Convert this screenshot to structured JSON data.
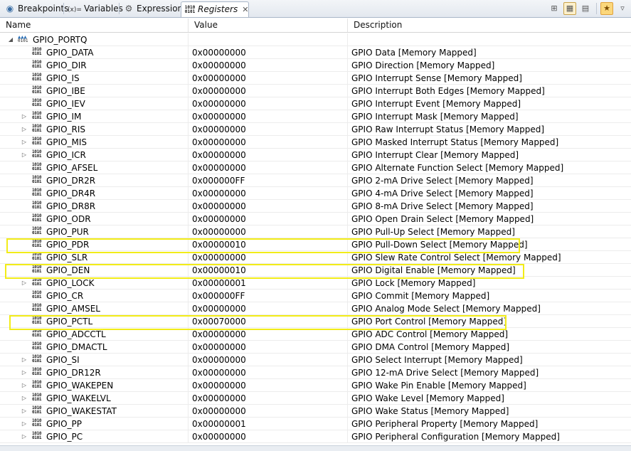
{
  "tabs": [
    {
      "label": "Breakpoints",
      "icon": "breakpoints-icon",
      "glyph": "⚬"
    },
    {
      "label": "Variables",
      "icon": "variables-icon",
      "glyph": "(x)="
    },
    {
      "label": "Expressions",
      "icon": "expressions-icon",
      "glyph": "⛭"
    },
    {
      "label": "Registers",
      "icon": "registers-icon",
      "glyph": "1010"
    }
  ],
  "columns": {
    "name": "Name",
    "value": "Value",
    "description": "Description"
  },
  "group": {
    "name": "GPIO_PORTQ",
    "expanded": true
  },
  "registers": [
    {
      "name": "GPIO_DATA",
      "value": "0x00000000",
      "description": "GPIO Data [Memory Mapped]",
      "expandable": false
    },
    {
      "name": "GPIO_DIR",
      "value": "0x00000000",
      "description": "GPIO Direction [Memory Mapped]",
      "expandable": false
    },
    {
      "name": "GPIO_IS",
      "value": "0x00000000",
      "description": "GPIO Interrupt Sense [Memory Mapped]",
      "expandable": false
    },
    {
      "name": "GPIO_IBE",
      "value": "0x00000000",
      "description": "GPIO Interrupt Both Edges [Memory Mapped]",
      "expandable": false
    },
    {
      "name": "GPIO_IEV",
      "value": "0x00000000",
      "description": "GPIO Interrupt Event [Memory Mapped]",
      "expandable": false
    },
    {
      "name": "GPIO_IM",
      "value": "0x00000000",
      "description": "GPIO Interrupt Mask [Memory Mapped]",
      "expandable": true
    },
    {
      "name": "GPIO_RIS",
      "value": "0x00000000",
      "description": "GPIO Raw Interrupt Status [Memory Mapped]",
      "expandable": true
    },
    {
      "name": "GPIO_MIS",
      "value": "0x00000000",
      "description": "GPIO Masked Interrupt Status [Memory Mapped]",
      "expandable": true
    },
    {
      "name": "GPIO_ICR",
      "value": "0x00000000",
      "description": "GPIO Interrupt Clear [Memory Mapped]",
      "expandable": true
    },
    {
      "name": "GPIO_AFSEL",
      "value": "0x00000000",
      "description": "GPIO Alternate Function Select [Memory Mapped]",
      "expandable": false
    },
    {
      "name": "GPIO_DR2R",
      "value": "0x000000FF",
      "description": "GPIO 2-mA Drive Select [Memory Mapped]",
      "expandable": false
    },
    {
      "name": "GPIO_DR4R",
      "value": "0x00000000",
      "description": "GPIO 4-mA Drive Select [Memory Mapped]",
      "expandable": false
    },
    {
      "name": "GPIO_DR8R",
      "value": "0x00000000",
      "description": "GPIO 8-mA Drive Select [Memory Mapped]",
      "expandable": false
    },
    {
      "name": "GPIO_ODR",
      "value": "0x00000000",
      "description": "GPIO Open Drain Select [Memory Mapped]",
      "expandable": false
    },
    {
      "name": "GPIO_PUR",
      "value": "0x00000000",
      "description": "GPIO Pull-Up Select [Memory Mapped]",
      "expandable": false
    },
    {
      "name": "GPIO_PDR",
      "value": "0x00000010",
      "description": "GPIO Pull-Down Select [Memory Mapped]",
      "expandable": false,
      "highlighted": true
    },
    {
      "name": "GPIO_SLR",
      "value": "0x00000000",
      "description": "GPIO Slew Rate Control Select [Memory Mapped]",
      "expandable": false
    },
    {
      "name": "GPIO_DEN",
      "value": "0x00000010",
      "description": "GPIO Digital Enable [Memory Mapped]",
      "expandable": false,
      "highlighted": true
    },
    {
      "name": "GPIO_LOCK",
      "value": "0x00000001",
      "description": "GPIO Lock [Memory Mapped]",
      "expandable": true
    },
    {
      "name": "GPIO_CR",
      "value": "0x000000FF",
      "description": "GPIO Commit [Memory Mapped]",
      "expandable": false
    },
    {
      "name": "GPIO_AMSEL",
      "value": "0x00000000",
      "description": "GPIO Analog Mode Select [Memory Mapped]",
      "expandable": false
    },
    {
      "name": "GPIO_PCTL",
      "value": "0x00070000",
      "description": "GPIO Port Control [Memory Mapped]",
      "expandable": false,
      "highlighted": true
    },
    {
      "name": "GPIO_ADCCTL",
      "value": "0x00000000",
      "description": "GPIO ADC Control [Memory Mapped]",
      "expandable": false
    },
    {
      "name": "GPIO_DMACTL",
      "value": "0x00000000",
      "description": "GPIO DMA Control [Memory Mapped]",
      "expandable": false
    },
    {
      "name": "GPIO_SI",
      "value": "0x00000000",
      "description": "GPIO Select Interrupt [Memory Mapped]",
      "expandable": true
    },
    {
      "name": "GPIO_DR12R",
      "value": "0x00000000",
      "description": "GPIO 12-mA Drive Select [Memory Mapped]",
      "expandable": true
    },
    {
      "name": "GPIO_WAKEPEN",
      "value": "0x00000000",
      "description": "GPIO Wake Pin Enable [Memory Mapped]",
      "expandable": true
    },
    {
      "name": "GPIO_WAKELVL",
      "value": "0x00000000",
      "description": "GPIO Wake Level [Memory Mapped]",
      "expandable": true
    },
    {
      "name": "GPIO_WAKESTAT",
      "value": "0x00000000",
      "description": "GPIO Wake Status [Memory Mapped]",
      "expandable": true
    },
    {
      "name": "GPIO_PP",
      "value": "0x00000001",
      "description": "GPIO Peripheral Property [Memory Mapped]",
      "expandable": true
    },
    {
      "name": "GPIO_PC",
      "value": "0x00000000",
      "description": "GPIO Peripheral Configuration [Memory Mapped]",
      "expandable": true
    }
  ],
  "colors": {
    "highlight": "#f2ec18",
    "selection_accent": "#fbd77c"
  }
}
